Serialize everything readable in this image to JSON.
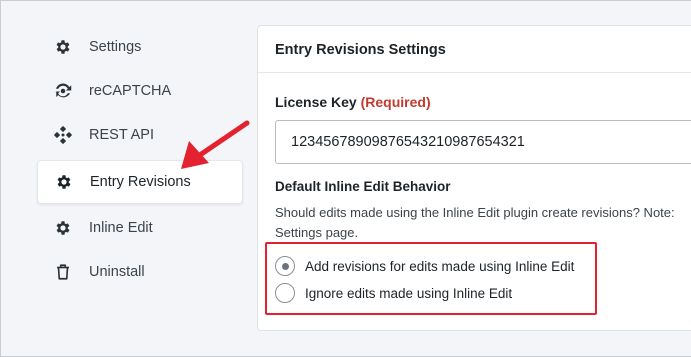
{
  "sidebar": {
    "items": [
      {
        "label": "Settings",
        "icon": "gear-icon"
      },
      {
        "label": "reCAPTCHA",
        "icon": "recaptcha-icon"
      },
      {
        "label": "REST API",
        "icon": "rest-api-icon"
      },
      {
        "label": "Entry Revisions",
        "icon": "gear-icon",
        "active": true
      },
      {
        "label": "Inline Edit",
        "icon": "gear-icon"
      },
      {
        "label": "Uninstall",
        "icon": "trash-icon"
      }
    ]
  },
  "panel": {
    "title": "Entry Revisions Settings",
    "license": {
      "label": "License Key",
      "required": "(Required)",
      "value": "12345678909876543210987654321"
    },
    "section_title": "Default Inline Edit Behavior",
    "description_line1": "Should edits made using the Inline Edit plugin create revisions? Note:",
    "description_line2": "Settings page.",
    "options": [
      {
        "label": "Add revisions for edits made using Inline Edit",
        "checked": true
      },
      {
        "label": "Ignore edits made using Inline Edit",
        "checked": false
      }
    ]
  },
  "colors": {
    "annotation_red": "#e3212f",
    "required_red": "#c23b2f"
  }
}
